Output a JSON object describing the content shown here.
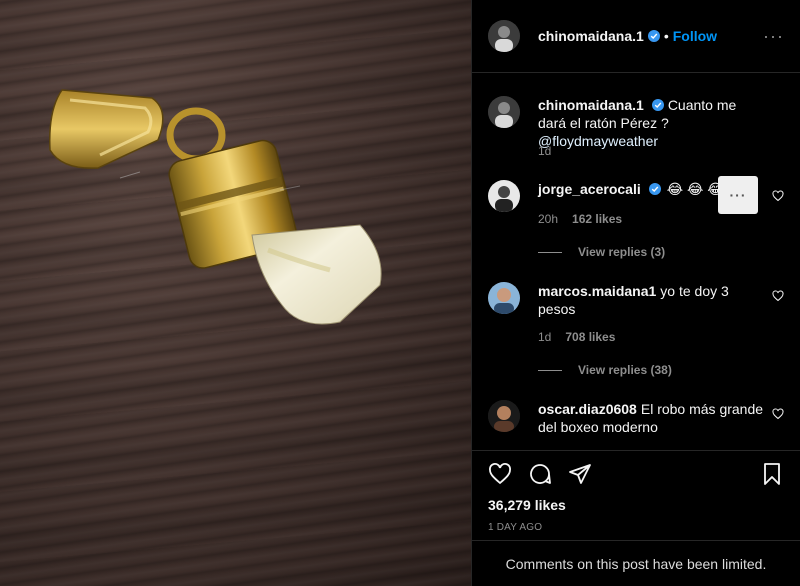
{
  "header": {
    "username": "chinomaidana.1",
    "dot": "•",
    "follow_label": "Follow",
    "more": "···"
  },
  "caption": {
    "username": "chinomaidana.1",
    "text": "Cuanto me dará el ratón Pérez ?",
    "mention": "@floydmayweather",
    "time": "1d"
  },
  "comments": [
    {
      "username": "jorge_acerocali",
      "text": "😂 😂 😂 🙇",
      "time": "20h",
      "likes": "162 likes",
      "view_replies": "View replies (3)"
    },
    {
      "username": "marcos.maidana1",
      "text": "yo te doy 3 pesos",
      "time": "1d",
      "likes": "708 likes",
      "view_replies": "View replies (38)"
    },
    {
      "username": "oscar.diaz0608",
      "text": "El robo más grande del boxeo moderno"
    }
  ],
  "comment_menu": "···",
  "footer": {
    "likes": "36,279 likes",
    "time_ago": "1 DAY AGO",
    "limited_notice": "Comments on this post have been limited."
  },
  "icons": {
    "like": "heart-icon",
    "comment": "comment-icon",
    "share": "share-icon",
    "save": "bookmark-icon",
    "verified": "verified-badge-icon"
  },
  "colors": {
    "accent": "#0095f6",
    "background": "#000000",
    "muted": "#8e8e8e"
  }
}
